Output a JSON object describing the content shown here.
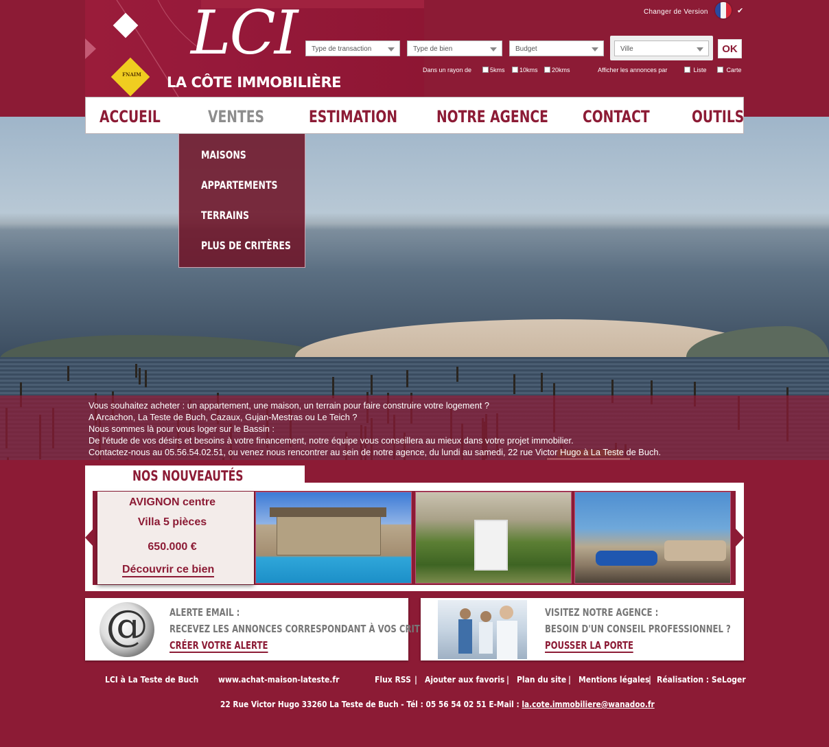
{
  "header": {
    "logo_text": "LCI",
    "tagline": "LA CÔTE IMMOBILIÈRE",
    "fnaim": "FNAIM",
    "version_label": "Changer de Version",
    "flag_icon": "france-flag-icon",
    "search": {
      "transaction_placeholder": "Type de transaction",
      "property_placeholder": "Type de bien",
      "budget_placeholder": "Budget",
      "city_placeholder": "Ville",
      "ok_label": "OK",
      "radius_label": "Dans un rayon de",
      "radius_5": "5kms",
      "radius_10": "10kms",
      "radius_20": "20kms",
      "display_label": "Afficher les annonces par",
      "display_list": "Liste",
      "display_map": "Carte"
    }
  },
  "nav": {
    "items": [
      "ACCUEIL",
      "VENTES",
      "ESTIMATION",
      "NOTRE AGENCE",
      "CONTACT",
      "OUTILS"
    ],
    "active": "VENTES",
    "dropdown": [
      "MAISONS",
      "APPARTEMENTS",
      "TERRAINS",
      "PLUS DE CRITÈRES"
    ]
  },
  "hero": {
    "caption": [
      "Vous souhaitez acheter : un appartement, une maison, un terrain pour faire construire votre logement ?",
      "A Arcachon, La Teste de Buch, Cazaux, Gujan-Mestras ou Le Teich ?",
      "Nous sommes là pour vous loger sur le Bassin :",
      "De l'étude de vos désirs et besoins à votre financement, notre équipe vous conseillera au mieux dans votre projet immobilier.",
      "Contactez-nous au 05.56.54.02.51, ou venez nous rencontrer au sein de notre agence, du lundi au samedi, 22 rue Victor Hugo à La Teste de Buch."
    ]
  },
  "news": {
    "title": "NOS NOUVEAUTÉS",
    "featured": {
      "city": "AVIGNON centre",
      "type": "Villa 5 pièces",
      "price": "650.000 €",
      "link": "Découvrir ce bien"
    }
  },
  "promos": {
    "alert": {
      "line1": "ALERTE EMAIL :",
      "line2": "RECEVEZ LES ANNONCES CORRESPONDANT À VOS CRITÈRES",
      "link": "CRÉER VOTRE ALERTE"
    },
    "agency": {
      "line1": "VISITEZ NOTRE AGENCE :",
      "line2": "BESOIN D'UN CONSEIL PROFESSIONNEL ?",
      "link": "POUSSER LA PORTE"
    }
  },
  "footer": {
    "agency_name": "LCI à La Teste de Buch",
    "website": "www.achat-maison-lateste.fr",
    "links": [
      "Flux RSS",
      "Ajouter aux favoris",
      "Plan du site",
      "Mentions légales",
      "Réalisation : SeLoger"
    ],
    "separator": "|",
    "address": "22 Rue Victor Hugo 33260 La Teste de Buch   -  Tél : 05 56 54 02 51  E-Mail : ",
    "email": "la.cote.immobiliere@wanadoo.fr"
  },
  "colors": {
    "brand": "#8c1b35",
    "nav_active": "#8d8d8d"
  }
}
